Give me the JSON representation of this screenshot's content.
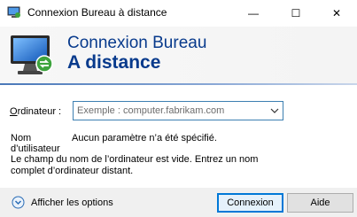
{
  "window": {
    "title": "Connexion Bureau à distance",
    "minimize_symbol": "—",
    "maximize_symbol": "☐",
    "close_symbol": "✕"
  },
  "banner": {
    "title": "Connexion Bureau",
    "subtitle": "A distance"
  },
  "form": {
    "computer_label_accel": "O",
    "computer_label_rest": "rdinateur :",
    "computer_placeholder": "Exemple : computer.fabrikam.com",
    "user_label": "Nom d’utilisateur :",
    "user_value": "Aucun paramètre n’a été spécifié.",
    "error_message": "Le champ du nom de l’ordinateur est vide. Entrez un nom complet d’ordinateur distant."
  },
  "footer": {
    "options_label": "Afficher les options",
    "connect_label": "Connexion",
    "help_label": "Aide"
  },
  "colors": {
    "banner_text": "#083a8c",
    "focus_border": "#0078d7"
  },
  "icons": {
    "app": "remote-desktop-icon",
    "banner": "remote-desktop-monitor-icon",
    "options": "chevron-down-circle-icon",
    "combo": "chevron-down-icon"
  }
}
